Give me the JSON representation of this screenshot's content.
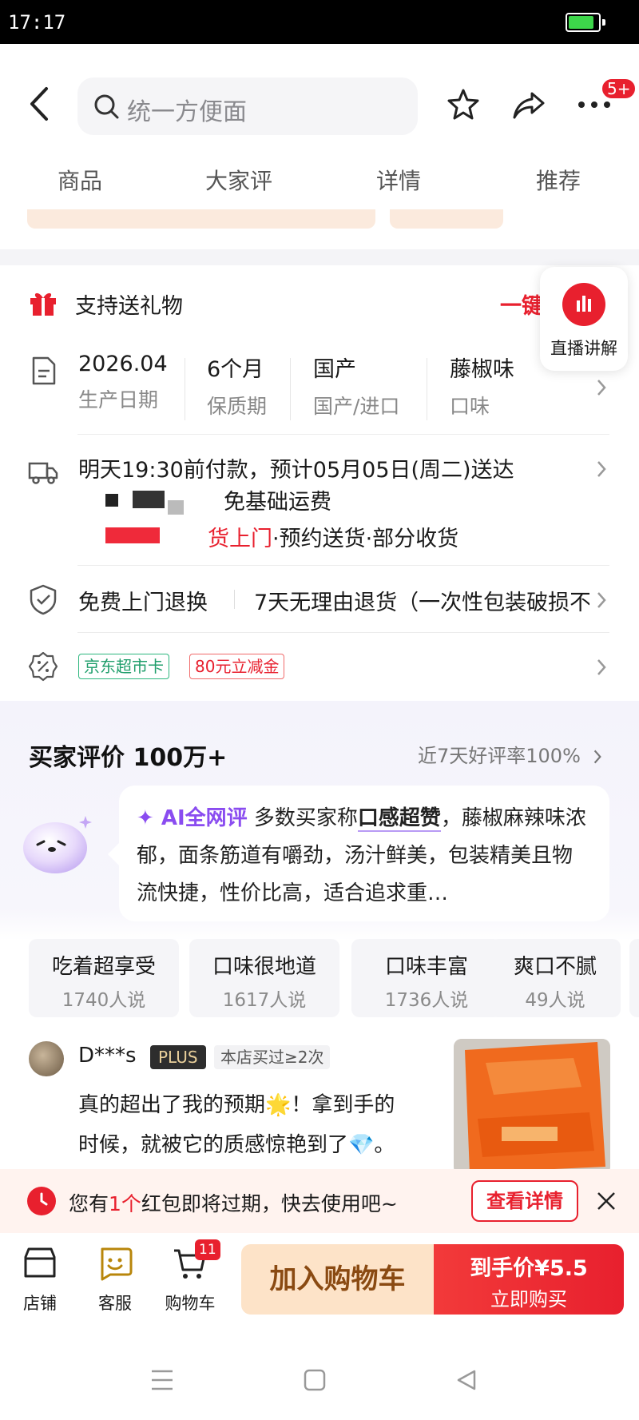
{
  "status_bar": {
    "time": "17:17",
    "battery_level": 0.85
  },
  "header": {
    "search_placeholder": "统一方便面",
    "more_badge": "5+"
  },
  "tabs": [
    {
      "label": "商品"
    },
    {
      "label": "大家评"
    },
    {
      "label": "详情"
    },
    {
      "label": "推荐"
    }
  ],
  "gift": {
    "label": "支持送礼物",
    "action": "一键送"
  },
  "live": {
    "label": "直播讲解"
  },
  "specs": [
    {
      "value": "2026.04",
      "key": "生产日期"
    },
    {
      "value": "6个月",
      "key": "保质期"
    },
    {
      "value": "国产",
      "key": "国产/进口"
    },
    {
      "value": "藤椒味",
      "key": "口味"
    }
  ],
  "delivery": {
    "line1": "明天19:30前付款，预计05月05日(周二)送达",
    "line2": "免基础运费",
    "line3_highlight": "货上门",
    "line3_rest": "·预约送货·部分收货"
  },
  "returns": {
    "label": "免费上门退换",
    "detail": "7天无理由退货（一次性包装破损不"
  },
  "promos": {
    "tag1": "京东超市卡",
    "tag2": "80元立减金"
  },
  "reviews": {
    "title": "买家评价 100万+",
    "rate": "近7天好评率100%",
    "ai_tag": "✦ AI全网评",
    "ai_pre": " 多数买家称",
    "ai_highlight": "口感超赞",
    "ai_post": "，藤椒麻辣味浓郁，面条筋道有嚼劲，汤汁鲜美，包装精美且物流快捷，性价比高，适合追求重…",
    "chips": [
      {
        "text": "吃着超享受",
        "count": "1740人说"
      },
      {
        "text": "口味很地道",
        "count": "1617人说"
      },
      {
        "text": "口味丰富",
        "count": "1736人说"
      },
      {
        "text": "爽口不腻",
        "count": "49人说"
      }
    ],
    "first": {
      "user": "D***s",
      "plus": "PLUS",
      "bought": "本店买过≥2次",
      "text1": "真的超出了我的预期🌟！拿到手的",
      "text2": "时候，就被它的质感惊艳到了💎。"
    }
  },
  "coupon": {
    "pre": "您有",
    "num": "1个",
    "post": "红包即将过期，快去使用吧~",
    "button": "查看详情"
  },
  "bottom": {
    "shop": "店铺",
    "service": "客服",
    "cart": "购物车",
    "cart_count": "11",
    "add_cart": "加入购物车",
    "price_label": "到手价¥5.5",
    "buy": "立即购买"
  },
  "colors": {
    "accent": "#e8202e",
    "ai": "#8a4cf0",
    "green_tag": "#1f9e6b"
  }
}
